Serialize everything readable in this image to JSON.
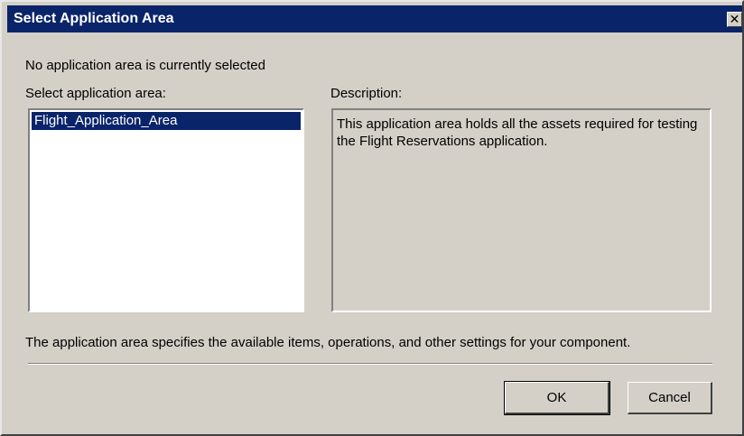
{
  "window": {
    "title": "Select Application Area",
    "close_glyph": "✕"
  },
  "status_text": "No application area is currently selected",
  "select_label": "Select application area:",
  "list_items": [
    "Flight_Application_Area"
  ],
  "selected_index": 0,
  "description_label": "Description:",
  "description_text": "This application area holds all the assets required for testing the Flight Reservations application.",
  "footer_text": "The application area specifies the available items, operations, and other settings for your component.",
  "buttons": {
    "ok": "OK",
    "cancel": "Cancel"
  },
  "colors": {
    "titlebar": "#0a246a",
    "selection": "#0a246a",
    "dialog_bg": "#d4d0c8"
  }
}
